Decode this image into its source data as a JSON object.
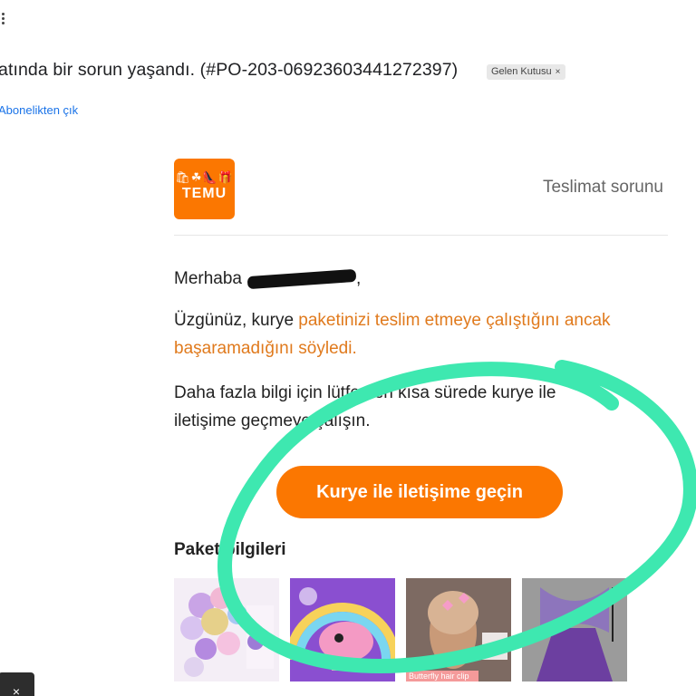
{
  "email": {
    "subject": "atında bir sorun yaşandı. (#PO-203-06923603441272397)",
    "label_chip": "Gelen Kutusu",
    "label_chip_close": "×",
    "unsubscribe": "Abonelikten çık"
  },
  "brand": {
    "logo_text": "TEMU",
    "logo_icons": "🛍☘👠🎁",
    "color": "#fb7701",
    "header_label": "Teslimat sorunu"
  },
  "body": {
    "greeting": "Merhaba",
    "greeting_end": ",",
    "sorry_plain": "Üzgünüz, kurye ",
    "sorry_highlight": "paketinizi teslim etmeye çalıştığını ancak başaramadığını söyledi.",
    "more_info_line1": "Daha fazla bilgi için lütfen en kısa sürede kurye ile",
    "more_info_line2": "iletişime geçmeye çalışın.",
    "cta_label": "Kurye ile iletişime geçin",
    "package_title": "Paket bilgileri",
    "highlight_color": "#e07a1d"
  },
  "products": [
    {
      "name": "balloon-garland-product",
      "caption": ""
    },
    {
      "name": "bubble-gun-product",
      "caption": ""
    },
    {
      "name": "butterfly-hair-clip-product",
      "caption": "Butterfly hair clip"
    },
    {
      "name": "fairy-costume-product",
      "caption": ""
    }
  ],
  "toast": {
    "close": "×"
  },
  "annotation": {
    "color": "#3ee8b0"
  }
}
